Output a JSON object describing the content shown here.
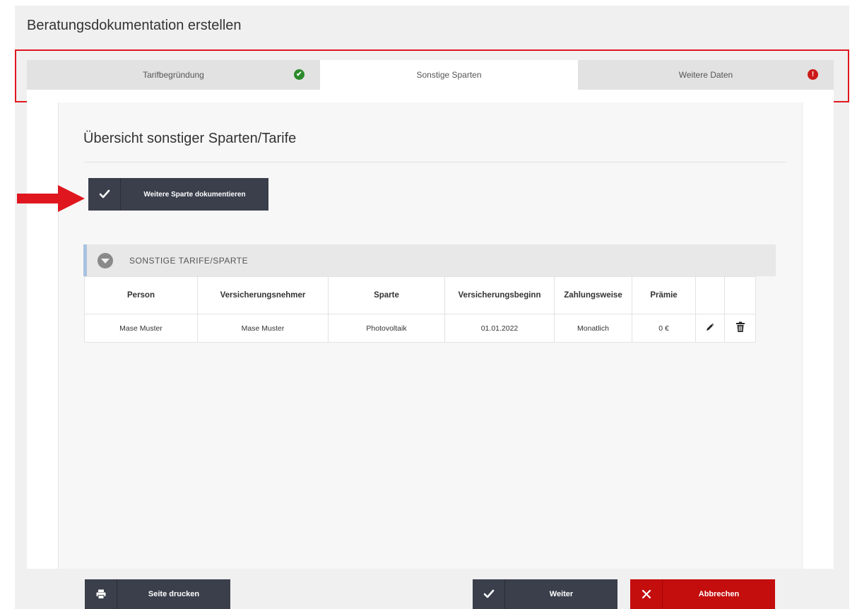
{
  "page": {
    "title": "Beratungsdokumentation erstellen"
  },
  "tabs": [
    {
      "label": "Tarifbegründung",
      "status": "ok",
      "status_glyph": "✔"
    },
    {
      "label": "Sonstige Sparten",
      "status": "",
      "status_glyph": ""
    },
    {
      "label": "Weitere Daten",
      "status": "error",
      "status_glyph": "!"
    }
  ],
  "section": {
    "title": "Übersicht sonstiger Sparten/Tarife",
    "add_button_label": "Weitere Sparte dokumentieren"
  },
  "accordion": {
    "title": "SONSTIGE TARIFE/SPARTE"
  },
  "table": {
    "headers": [
      "Person",
      "Versicherungsnehmer",
      "Sparte",
      "Versicherungsbeginn",
      "Zahlungsweise",
      "Prämie",
      "",
      ""
    ],
    "rows": [
      {
        "person": "Mase Muster",
        "versicherungsnehmer": "Mase Muster",
        "sparte": "Photovoltaik",
        "beginn": "01.01.2022",
        "zahlungsweise": "Monatlich",
        "praemie": "0 €"
      }
    ]
  },
  "footer": {
    "print_label": "Seite drucken",
    "next_label": "Weiter",
    "cancel_label": "Abbrechen"
  },
  "icons": {
    "tab_ok": "check-circle-icon",
    "tab_error": "exclamation-circle-icon",
    "add": "checkmark-icon",
    "print": "printer-icon",
    "next": "checkmark-icon",
    "cancel": "close-icon",
    "edit": "pencil-icon",
    "delete": "trash-icon"
  },
  "colors": {
    "highlight_frame": "#e0161e",
    "dark_button": "#3a3f4b",
    "cancel_button": "#c40d0d",
    "status_ok": "#2b8a2b",
    "status_error": "#cc1a1a",
    "accordion_accent": "#a9c2e0"
  }
}
